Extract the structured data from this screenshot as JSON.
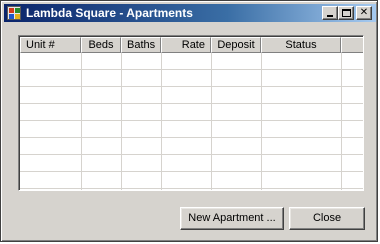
{
  "window": {
    "title": "Lambda Square - Apartments",
    "controls": {
      "minimize": "minimize",
      "maximize": "maximize",
      "close": "✕"
    }
  },
  "table": {
    "columns": [
      "Unit #",
      "Beds",
      "Baths",
      "Rate",
      "Deposit",
      "Status",
      ""
    ],
    "rows": []
  },
  "buttons": {
    "new_apartment": "New Apartment ...",
    "close": "Close"
  },
  "colors": {
    "title_start": "#0a246a",
    "title_end": "#a6caf0",
    "face": "#d6d3ce"
  }
}
